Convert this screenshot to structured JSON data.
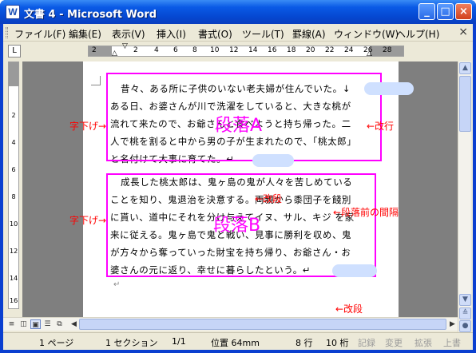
{
  "window": {
    "title": "文書 4 - Microsoft Word",
    "minimize_icon": "_",
    "maximize_icon": "□",
    "close_icon": "×"
  },
  "menu": {
    "items": [
      "ファイル(F)",
      "編集(E)",
      "表示(V)",
      "挿入(I)",
      "書式(O)",
      "ツール(T)",
      "罫線(A)",
      "ウィンドウ(W)",
      "ヘルプ(H)"
    ],
    "close_icon": "×"
  },
  "ruler": {
    "tab_selector": "L",
    "numbers": [
      "2",
      "2",
      "4",
      "6",
      "8",
      "10",
      "12",
      "14",
      "16",
      "18",
      "20",
      "22",
      "24",
      "26",
      "28"
    ],
    "vertical_numbers": [
      "2",
      "4",
      "6",
      "8",
      "10",
      "12",
      "14",
      "16"
    ]
  },
  "document": {
    "paragraph_a": [
      "昔々、ある所に子供のいない老夫婦が住んでいた。↓",
      "ある日、お婆さんが川で洗濯をしていると、大きな桃が",
      "流れて来たので、お爺さんと食べようと持ち帰った。二",
      "人で桃を割ると中から男の子が生まれたので、「桃太郎」",
      "と名付けて大事に育てた。↵"
    ],
    "paragraph_b": [
      "成長した桃太郎は、鬼ヶ島の鬼が人々を苦しめている",
      "ことを知り、鬼退治を決意する。両親から黍団子を餞別",
      "に貰い、道中にそれを分け与えてイヌ、サル、キジ を家",
      "来に従える。鬼ヶ島で鬼と戦い、見事に勝利を収め、鬼",
      "が方々から奪っていった財宝を持ち帰り、お爺さん・お",
      "婆さんの元に返り、幸せに暮らしたという。↵"
    ],
    "trailing_mark": "↵"
  },
  "annotations": {
    "label_a": "段落A",
    "label_b": "段落B",
    "indent_a": "字下げ→",
    "indent_b": "字下げ→",
    "kaigyo": "←改行",
    "kaidan_a": "←改段",
    "kaidan_b": "←改段",
    "spacing": "←段落前の間隔"
  },
  "statusbar": {
    "page": "1 ページ",
    "section": "1 セクション",
    "pages": "1/1",
    "position": "位置 64mm",
    "line": "8 行",
    "column": "10 桁",
    "rec": "記録",
    "trk": "変更",
    "ext": "拡張",
    "ovr": "上書"
  },
  "colors": {
    "annotation_box": "#ff00ff",
    "annotation_text": "#ff0000",
    "title_bar": "#0548d1"
  }
}
